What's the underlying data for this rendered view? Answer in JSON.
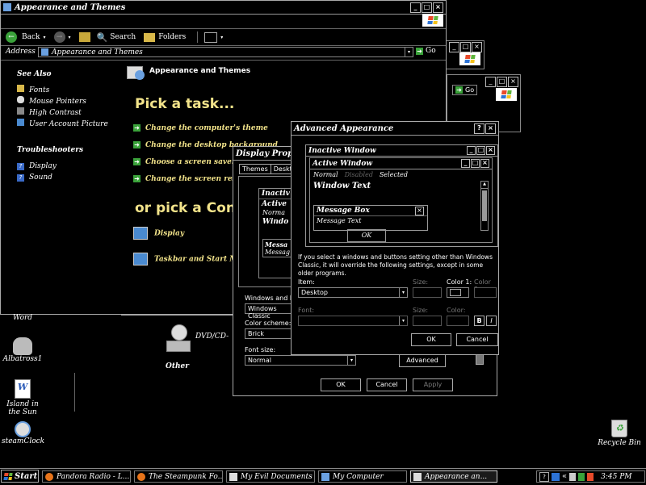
{
  "colors": {
    "gold": "#f2e38a",
    "green": "#3aa23a",
    "border": "#c9c9c9"
  },
  "main_window": {
    "title": "Appearance and Themes",
    "toolbar": {
      "back": "Back",
      "search": "Search",
      "folders": "Folders"
    },
    "address_label": "Address",
    "address_value": "Appearance and Themes",
    "go": "Go",
    "see_also_title": "See Also",
    "see_also": [
      "Fonts",
      "Mouse Pointers",
      "High Contrast",
      "User Account Picture"
    ],
    "troubleshooters_title": "Troubleshooters",
    "troubleshooters": [
      "Display",
      "Sound"
    ],
    "header_title": "Appearance and Themes",
    "pick_task": "Pick a task...",
    "tasks": [
      "Change the computer's theme",
      "Change the desktop background",
      "Choose a screen saver",
      "Change the screen reso"
    ],
    "or_pick": "or pick a Cont",
    "cp_items": [
      "Display",
      "Taskbar and Start M"
    ]
  },
  "bg_windows": {
    "go1": "Go"
  },
  "my_computer_fragment": {
    "drive": "DVD/CD-",
    "other": "Other"
  },
  "display_properties": {
    "title": "Display Prope",
    "tabs": [
      "Themes",
      "Desktop"
    ],
    "inactive": "Inactiv",
    "active": "Active",
    "normal": "Norma",
    "window": "Windo",
    "message": "Messa",
    "message_text": "Messag",
    "windows_buttons_label": "Windows and butt",
    "windows_buttons_value": "Windows Classic",
    "color_scheme_label": "Color scheme:",
    "color_scheme_value": "Brick",
    "font_size_label": "Font size:",
    "font_size_value": "Normal",
    "advanced": "Advanced",
    "ok": "OK",
    "cancel": "Cancel",
    "apply": "Apply"
  },
  "advanced_appearance": {
    "title": "Advanced Appearance",
    "inactive_window": "Inactive Window",
    "active_window": "Active Window",
    "normal": "Normal",
    "disabled": "Disabled",
    "selected": "Selected",
    "window_text": "Window Text",
    "message_box": "Message Box",
    "message_text": "Message Text",
    "msg_ok": "OK",
    "info": "If you select a windows and buttons setting other than Windows Classic, it will override the following settings, except in some older programs.",
    "item_label": "Item:",
    "item_value": "Desktop",
    "size_label": "Size:",
    "color1_label": "Color 1:",
    "color2_label": "Color 2:",
    "font_label": "Font:",
    "size2_label": "Size:",
    "color_label": "Color:",
    "bold": "B",
    "italic": "I",
    "ok": "OK",
    "cancel": "Cancel"
  },
  "desktop_icons": [
    "Word",
    "Albatross1",
    "Island in the Sun",
    "steamClock",
    "Recycle Bin"
  ],
  "taskbar": {
    "start": "Start",
    "items": [
      "Pandora Radio - L...",
      "The Steampunk Fo...",
      "My Evil Documents",
      "My Computer",
      "Appearance an..."
    ],
    "clock": "3:45 PM",
    "tray_arrow": "«"
  }
}
